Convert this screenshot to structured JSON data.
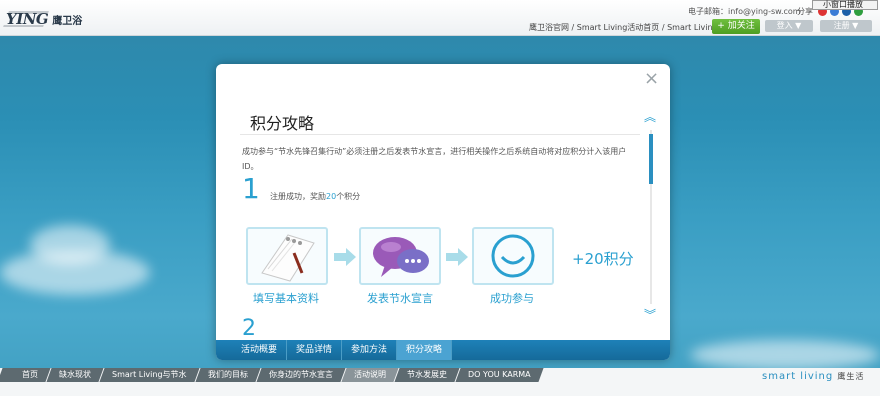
{
  "header": {
    "logo_mark": "YING",
    "logo_text": "鹰卫浴",
    "email": "电子邮箱：info@ying-sw.com",
    "share": "分享",
    "popup_button": "小窗口播放",
    "breadcrumb": "鹰卫浴官网 / Smart Living活动首页 / Smart Living微博",
    "follow_button": "+ 加关注",
    "login_button": "登入 ▼",
    "register_button": "注册 ▼"
  },
  "modal": {
    "close": "×",
    "title": "积分攻略",
    "description": "成功参与“节水先锋召集行动”必须注册之后发表节水宣言，进行相关操作之后系统自动将对应积分计入该用户ID。",
    "step1": {
      "number": "1",
      "text_before": "注册成功，奖励",
      "points": "20",
      "text_after": "个积分"
    },
    "flow": [
      {
        "label": "填写基本资料",
        "icon": "notepad-icon"
      },
      {
        "label": "发表节水宣言",
        "icon": "speech-bubbles-icon"
      },
      {
        "label": "成功参与",
        "icon": "smile-icon"
      }
    ],
    "reward": "+20积分",
    "step2_number": "2",
    "tabs": [
      {
        "label": "活动概要",
        "active": false
      },
      {
        "label": "奖品详情",
        "active": false
      },
      {
        "label": "参加方法",
        "active": false
      },
      {
        "label": "积分攻略",
        "active": true
      }
    ]
  },
  "footer": {
    "nav": [
      {
        "label": "首页",
        "active": false
      },
      {
        "label": "缺水现状",
        "active": false
      },
      {
        "label": "Smart Living与节水",
        "active": false
      },
      {
        "label": "我们的目标",
        "active": false
      },
      {
        "label": "你身边的节水宣言",
        "active": false
      },
      {
        "label": "活动说明",
        "active": true
      },
      {
        "label": "节水发展史",
        "active": false
      },
      {
        "label": "DO YOU KARMA",
        "active": false
      }
    ],
    "brand": "smart living",
    "brand_cn": "鹰生活"
  },
  "colors": {
    "accent": "#2aa0d0",
    "tab_bar": "#1e81b8",
    "follow": "#4e9e22"
  }
}
